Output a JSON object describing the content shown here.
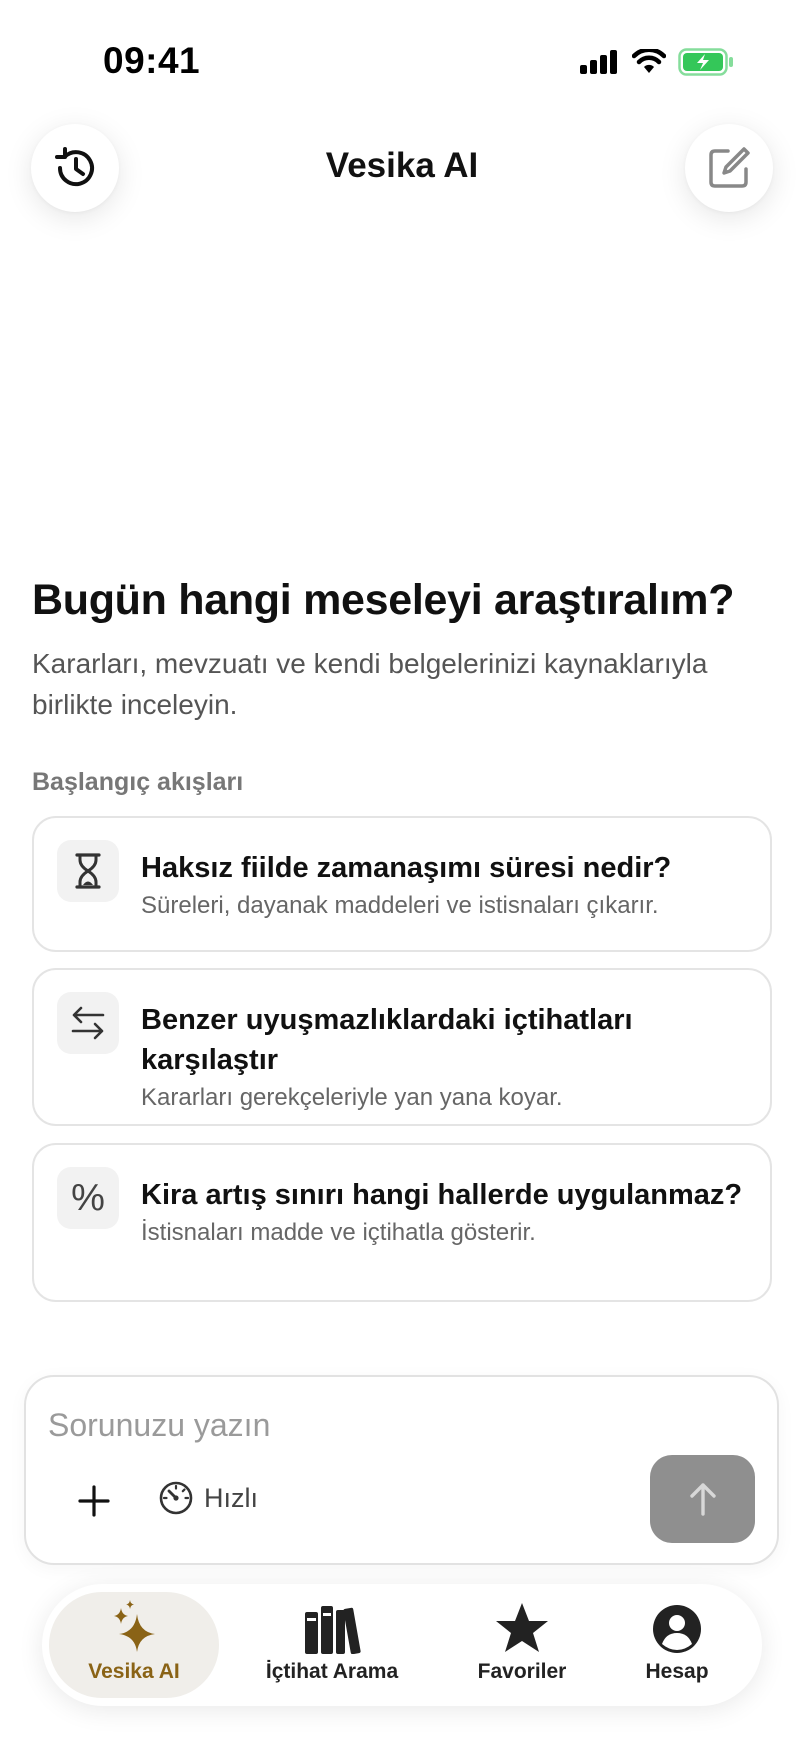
{
  "status_bar": {
    "time": "09:41",
    "icons": [
      "signal-icon",
      "wifi-icon",
      "battery-charging-icon"
    ]
  },
  "header": {
    "title": "Vesika AI",
    "left_icon": "history-icon",
    "right_icon": "compose-icon"
  },
  "hero": {
    "title": "Bugün hangi meseleyi araştıralım?",
    "subtitle": "Kararları, mevzuatı ve kendi belgelerinizi kaynaklarıyla birlikte inceleyin."
  },
  "flows": {
    "label": "Başlangıç akışları",
    "items": [
      {
        "icon": "hourglass-icon",
        "title": "Haksız fiilde zamanaşımı süresi nedir?",
        "desc": "Süreleri, dayanak maddeleri ve istisnaları çıkarır."
      },
      {
        "icon": "arrows-swap-icon",
        "title": "Benzer uyuşmazlıklardaki içtihatları karşılaştır",
        "desc": "Kararları gerekçeleriyle yan yana koyar."
      },
      {
        "icon": "percent-icon",
        "glyph": "%",
        "title": "Kira artış sınırı hangi hallerde uygulanmaz?",
        "desc": "İstisnaları madde ve içtihatla gösterir."
      }
    ]
  },
  "composer": {
    "placeholder": "Sorunuzu yazın",
    "value": "",
    "mode_label": "Hızlı",
    "mode_icon": "speedometer-icon"
  },
  "tabbar": {
    "active_color": "#8a6316",
    "items": [
      {
        "label": "Vesika AI",
        "icon": "sparkles-icon",
        "active": true
      },
      {
        "label": "İçtihat Arama",
        "icon": "books-icon",
        "active": false
      },
      {
        "label": "Favoriler",
        "icon": "star-icon",
        "active": false
      },
      {
        "label": "Hesap",
        "icon": "person-circle-icon",
        "active": false
      }
    ]
  }
}
